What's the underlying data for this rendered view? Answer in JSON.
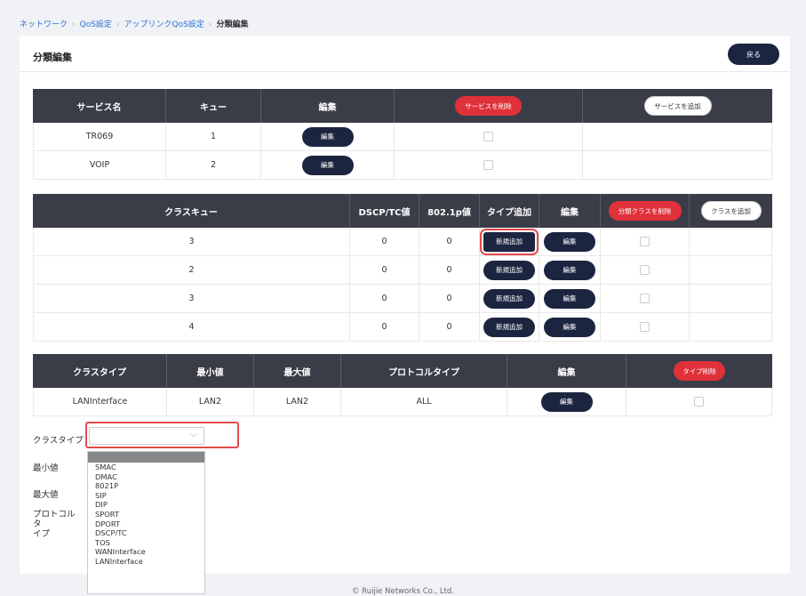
{
  "breadcrumb": {
    "items": [
      "ネットワーク",
      "QoS設定",
      "アップリンクQoS設定"
    ],
    "current": "分類編集",
    "separator": "›"
  },
  "page": {
    "title": "分類編集",
    "back_label": "戻る"
  },
  "service_table": {
    "headers": [
      "サービス名",
      "キュー",
      "編集"
    ],
    "delete_label": "サービスを削除",
    "add_label": "サービスを追加",
    "edit_label": "編集",
    "rows": [
      {
        "name": "TR069",
        "queue": "1"
      },
      {
        "name": "VOIP",
        "queue": "2"
      }
    ]
  },
  "class_queue_table": {
    "headers": [
      "クラスキュー",
      "DSCP/TC値",
      "802.1p値",
      "タイプ追加",
      "編集"
    ],
    "delete_label": "分類クラスを削除",
    "add_label": "クラスを追加",
    "new_add_label": "新規追加",
    "edit_label": "編集",
    "rows": [
      {
        "queue": "3",
        "dscp": "0",
        "p8021": "0"
      },
      {
        "queue": "2",
        "dscp": "0",
        "p8021": "0"
      },
      {
        "queue": "3",
        "dscp": "0",
        "p8021": "0"
      },
      {
        "queue": "4",
        "dscp": "0",
        "p8021": "0"
      }
    ]
  },
  "class_type_table": {
    "headers": [
      "クラスタイプ",
      "最小値",
      "最大値",
      "プロトコルタイプ",
      "編集"
    ],
    "delete_label": "タイプ削除",
    "edit_label": "編集",
    "rows": [
      {
        "type": "LANInterface",
        "min": "LAN2",
        "max": "LAN2",
        "protocol": "ALL"
      }
    ]
  },
  "form": {
    "class_type_label": "クラスタイプ",
    "min_label": "最小値",
    "max_label": "最大値",
    "protocol_label": "プロトコルタ\nイプ",
    "select_value": ""
  },
  "dropdown_options": [
    "SMAC",
    "DMAC",
    "8021P",
    "SIP",
    "DIP",
    "SPORT",
    "DPORT",
    "DSCP/TC",
    "TOS",
    "WANInterface",
    "LANInterface"
  ],
  "footer": {
    "copyright": "© Ruijie Networks Co., Ltd."
  },
  "colors": {
    "header_bg": "#3a3d48",
    "dark_button": "#1c2540",
    "red_button": "#e0303a",
    "highlight": "#e34b4b",
    "link": "#2b6fd6"
  }
}
